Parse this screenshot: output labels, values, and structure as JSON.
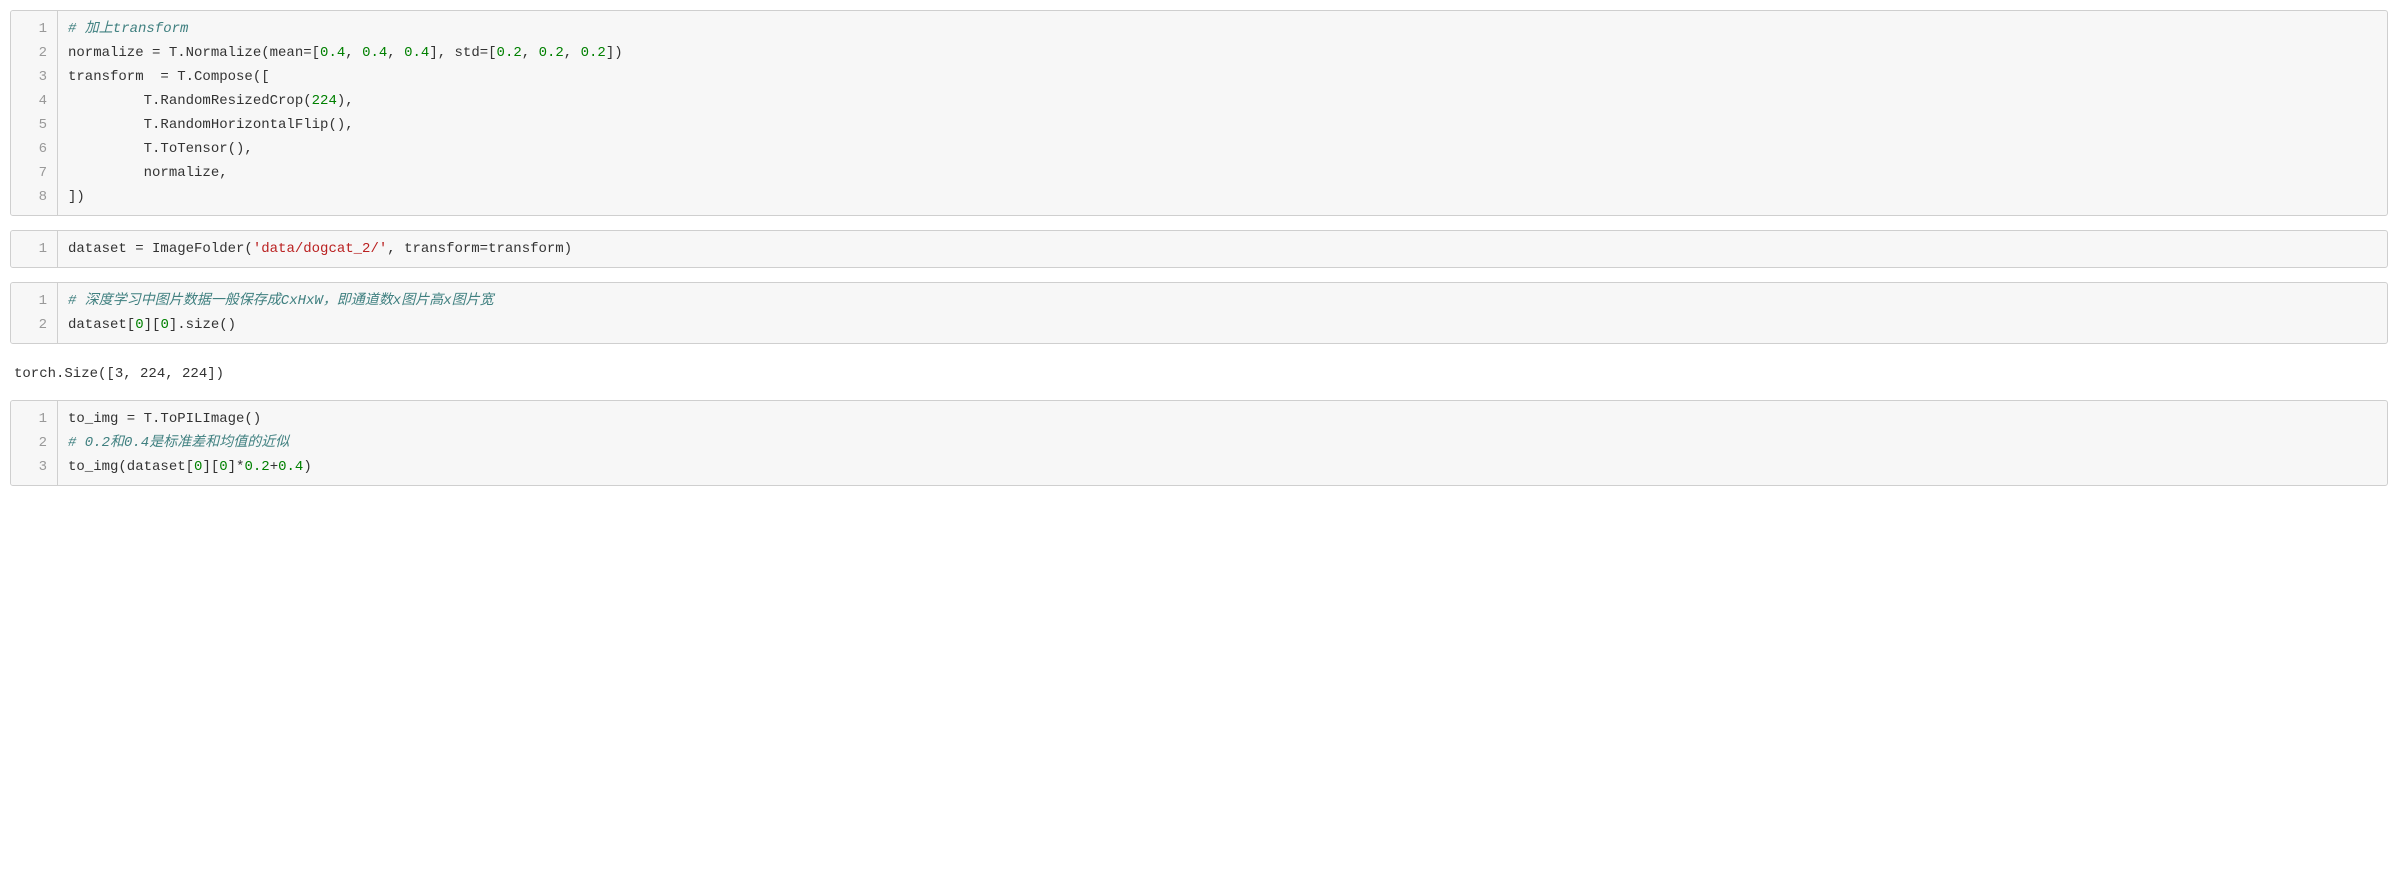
{
  "blocks": [
    {
      "type": "code",
      "lines": [
        [
          {
            "cls": "c-comment",
            "t": "# 加上transform"
          }
        ],
        [
          {
            "cls": "c-plain",
            "t": "normalize = T.Normalize(mean=["
          },
          {
            "cls": "c-num",
            "t": "0.4"
          },
          {
            "cls": "c-plain",
            "t": ", "
          },
          {
            "cls": "c-num",
            "t": "0.4"
          },
          {
            "cls": "c-plain",
            "t": ", "
          },
          {
            "cls": "c-num",
            "t": "0.4"
          },
          {
            "cls": "c-plain",
            "t": "], std=["
          },
          {
            "cls": "c-num",
            "t": "0.2"
          },
          {
            "cls": "c-plain",
            "t": ", "
          },
          {
            "cls": "c-num",
            "t": "0.2"
          },
          {
            "cls": "c-plain",
            "t": ", "
          },
          {
            "cls": "c-num",
            "t": "0.2"
          },
          {
            "cls": "c-plain",
            "t": "])"
          }
        ],
        [
          {
            "cls": "c-plain",
            "t": "transform  = T.Compose(["
          }
        ],
        [
          {
            "cls": "c-plain",
            "t": "         T.RandomResizedCrop("
          },
          {
            "cls": "c-num",
            "t": "224"
          },
          {
            "cls": "c-plain",
            "t": "),"
          }
        ],
        [
          {
            "cls": "c-plain",
            "t": "         T.RandomHorizontalFlip(),"
          }
        ],
        [
          {
            "cls": "c-plain",
            "t": "         T.ToTensor(),"
          }
        ],
        [
          {
            "cls": "c-plain",
            "t": "         normalize,"
          }
        ],
        [
          {
            "cls": "c-plain",
            "t": "])"
          }
        ]
      ]
    },
    {
      "type": "code",
      "lines": [
        [
          {
            "cls": "c-plain",
            "t": "dataset = ImageFolder("
          },
          {
            "cls": "c-str",
            "t": "'data/dogcat_2/'"
          },
          {
            "cls": "c-plain",
            "t": ", transform=transform)"
          }
        ]
      ]
    },
    {
      "type": "code",
      "lines": [
        [
          {
            "cls": "c-comment",
            "t": "# 深度学习中图片数据一般保存成CxHxW，即通道数x图片高x图片宽"
          }
        ],
        [
          {
            "cls": "c-plain",
            "t": "dataset["
          },
          {
            "cls": "c-num",
            "t": "0"
          },
          {
            "cls": "c-plain",
            "t": "]["
          },
          {
            "cls": "c-num",
            "t": "0"
          },
          {
            "cls": "c-plain",
            "t": "].size()"
          }
        ]
      ]
    },
    {
      "type": "output",
      "text": "torch.Size([3, 224, 224])"
    },
    {
      "type": "code",
      "lines": [
        [
          {
            "cls": "c-plain",
            "t": "to_img = T.ToPILImage()"
          }
        ],
        [
          {
            "cls": "c-comment",
            "t": "# 0.2和0.4是标准差和均值的近似"
          }
        ],
        [
          {
            "cls": "c-plain",
            "t": "to_img(dataset["
          },
          {
            "cls": "c-num",
            "t": "0"
          },
          {
            "cls": "c-plain",
            "t": "]["
          },
          {
            "cls": "c-num",
            "t": "0"
          },
          {
            "cls": "c-plain",
            "t": "]*"
          },
          {
            "cls": "c-num",
            "t": "0.2"
          },
          {
            "cls": "c-plain",
            "t": "+"
          },
          {
            "cls": "c-num",
            "t": "0.4"
          },
          {
            "cls": "c-plain",
            "t": ")"
          }
        ]
      ]
    }
  ],
  "watermark": ""
}
